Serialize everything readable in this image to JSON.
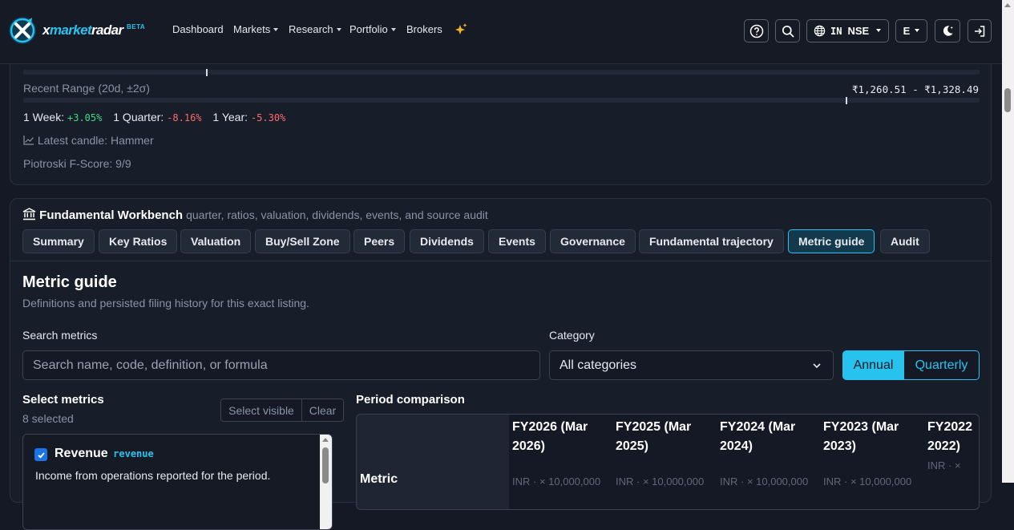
{
  "navbar": {
    "brand": {
      "prefix": "x",
      "accent": "market",
      "suffix": "radar",
      "badge": "BETA"
    },
    "links": [
      {
        "label": "Dashboard",
        "has_menu": false
      },
      {
        "label": "Markets",
        "has_menu": true
      },
      {
        "label": "Research",
        "has_menu": true
      },
      {
        "label": "Portfolio",
        "has_menu": true
      },
      {
        "label": "Brokers",
        "has_menu": false
      }
    ],
    "market_selector": {
      "country": "IN",
      "exchange": "NSE"
    },
    "language": "E",
    "icons": [
      "help-icon",
      "search-icon",
      "globe-icon",
      "moon-icon",
      "login-icon",
      "sparkle-icon"
    ]
  },
  "price_card": {
    "recent_range_label": "Recent Range (20d, ±2σ)",
    "recent_range_value": "₹1,260.51 - ₹1,328.49",
    "returns": [
      {
        "label": "1 Week:",
        "value": "+3.05%",
        "positive": true
      },
      {
        "label": "1 Quarter:",
        "value": "-8.16%",
        "positive": false
      },
      {
        "label": "1 Year:",
        "value": "-5.30%",
        "positive": false
      }
    ],
    "latest_candle": "Latest candle: Hammer",
    "piotroski": "Piotroski F-Score: 9/9"
  },
  "workbench": {
    "title": "Fundamental Workbench",
    "subtitle": "quarter, ratios, valuation, dividends, events, and source audit",
    "tabs": [
      "Summary",
      "Key Ratios",
      "Valuation",
      "Buy/Sell Zone",
      "Peers",
      "Dividends",
      "Events",
      "Governance",
      "Fundamental trajectory",
      "Metric guide",
      "Audit"
    ],
    "active_tab": "Metric guide",
    "section_title": "Metric guide",
    "section_desc": "Definitions and persisted filing history for this exact listing.",
    "search": {
      "label": "Search metrics",
      "placeholder": "Search name, code, definition, or formula",
      "value": ""
    },
    "category": {
      "label": "Category",
      "value": "All categories"
    },
    "period_toggle": {
      "annual": "Annual",
      "quarterly": "Quarterly",
      "selected": "Annual"
    },
    "select_metrics": {
      "title": "Select metrics",
      "count": "8 selected",
      "select_visible": "Select visible",
      "clear": "Clear",
      "items": [
        {
          "name": "Revenue",
          "code": "revenue",
          "description": "Income from operations reported for the period.",
          "checked": true
        }
      ]
    },
    "period_comparison": {
      "title": "Period comparison",
      "metric_header": "Metric",
      "columns": [
        {
          "line1": "FY2026 (Mar",
          "line2": "2026)",
          "unit": "INR · × 10,000,000"
        },
        {
          "line1": "FY2025 (Mar",
          "line2": "2025)",
          "unit": "INR · × 10,000,000"
        },
        {
          "line1": "FY2024 (Mar",
          "line2": "2024)",
          "unit": "INR · × 10,000,000"
        },
        {
          "line1": "FY2023 (Mar",
          "line2": "2023)",
          "unit": "INR · × 10,000,000"
        },
        {
          "line1": "FY2022",
          "line2": "2022)",
          "unit": "INR · ×"
        }
      ]
    }
  },
  "colors": {
    "accent": "#27c3ee",
    "positive": "#3ddc84",
    "negative": "#ff6b6b",
    "background": "#141925"
  }
}
